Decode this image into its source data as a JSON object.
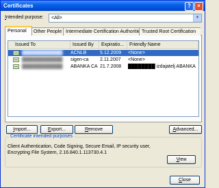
{
  "window": {
    "title": "Certificates",
    "help_glyph": "?",
    "close_glyph": "×"
  },
  "purpose": {
    "label_prefix": "I",
    "label_rest": "ntended purpose:",
    "value": "<All>",
    "arrow": "▼"
  },
  "tabs": [
    {
      "label": "Personal",
      "active": true
    },
    {
      "label": "Other People"
    },
    {
      "label": "Intermediate Certification Authorities"
    },
    {
      "label": "Trusted Root Certification"
    }
  ],
  "table": {
    "columns": [
      "Issued To",
      "Issued By",
      "Expiratio...",
      "Friendly Name"
    ],
    "rows": [
      {
        "issued_to": "████████████",
        "issued_by": "ACNLB",
        "expiration": "5.12.2009",
        "friendly_name": "<None>",
        "selected": true
      },
      {
        "issued_to": "████████████",
        "issued_by": "sigen-ca",
        "expiration": "2.11.2007",
        "friendly_name": "<None>"
      },
      {
        "issued_to": "████████████",
        "issued_by": "ABANKA CA",
        "expiration": "21.7.2008",
        "friendly_name": "████████ izdajatelj ABANKA"
      }
    ]
  },
  "buttons": {
    "import_u": "I",
    "import_rest": "mport...",
    "export_u": "E",
    "export_rest": "xport...",
    "remove_u": "R",
    "remove_rest": "emove",
    "advanced_u": "A",
    "advanced_rest": "dvanced...",
    "view_u": "V",
    "view_rest": "iew",
    "close_u": "C",
    "close_rest": "lose"
  },
  "purposes_group": {
    "label": "Certificate intended purposes",
    "text": "Client Authentication, Code Signing, Secure Email, IP security user, Encrypting File System, 2.16.840.1.113730.4.1"
  },
  "colors": {
    "titlebar": "#0054e3",
    "selection": "#316ac5",
    "tab_highlight": "#ffc83c",
    "group_label": "#0046d5"
  }
}
